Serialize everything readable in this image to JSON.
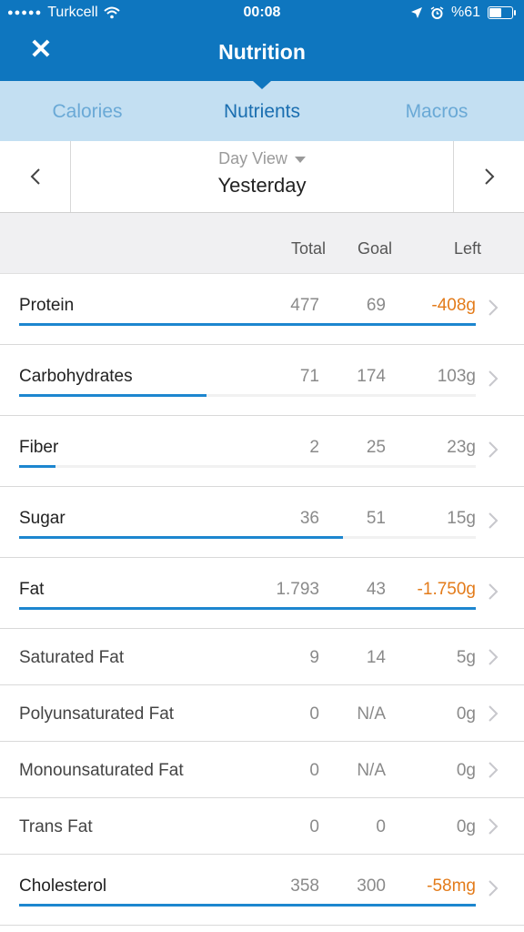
{
  "status_bar": {
    "signal": "●●●●●",
    "carrier": "Turkcell",
    "time": "00:08",
    "battery_text": "%61",
    "battery_level": 0.61
  },
  "nav": {
    "title": "Nutrition",
    "close_icon": "✕"
  },
  "tabs": [
    {
      "label": "Calories",
      "active": false
    },
    {
      "label": "Nutrients",
      "active": true
    },
    {
      "label": "Macros",
      "active": false
    }
  ],
  "day": {
    "view_label": "Day View",
    "date_label": "Yesterday"
  },
  "columns": {
    "total": "Total",
    "goal": "Goal",
    "left": "Left"
  },
  "nutrients": [
    {
      "name": "Protein",
      "total": "477",
      "goal": "69",
      "left": "-408g",
      "over": true,
      "progress": 1.0
    },
    {
      "name": "Carbohydrates",
      "total": "71",
      "goal": "174",
      "left": "103g",
      "over": false,
      "progress": 0.41
    },
    {
      "name": "Fiber",
      "total": "2",
      "goal": "25",
      "left": "23g",
      "over": false,
      "progress": 0.08
    },
    {
      "name": "Sugar",
      "total": "36",
      "goal": "51",
      "left": "15g",
      "over": false,
      "progress": 0.71
    },
    {
      "name": "Fat",
      "total": "1.793",
      "goal": "43",
      "left": "-1.750g",
      "over": true,
      "progress": 1.0
    },
    {
      "name": "Saturated Fat",
      "total": "9",
      "goal": "14",
      "left": "5g",
      "over": false,
      "progress": null
    },
    {
      "name": "Polyunsaturated Fat",
      "total": "0",
      "goal": "N/A",
      "left": "0g",
      "over": false,
      "progress": null
    },
    {
      "name": "Monounsaturated Fat",
      "total": "0",
      "goal": "N/A",
      "left": "0g",
      "over": false,
      "progress": null
    },
    {
      "name": "Trans Fat",
      "total": "0",
      "goal": "0",
      "left": "0g",
      "over": false,
      "progress": null
    },
    {
      "name": "Cholesterol",
      "total": "358",
      "goal": "300",
      "left": "-58mg",
      "over": true,
      "progress": 1.0
    }
  ],
  "colors": {
    "brand": "#0e76bf",
    "tab_bg": "#c3dff2",
    "progress": "#1d86cf",
    "over": "#e37b1a"
  }
}
